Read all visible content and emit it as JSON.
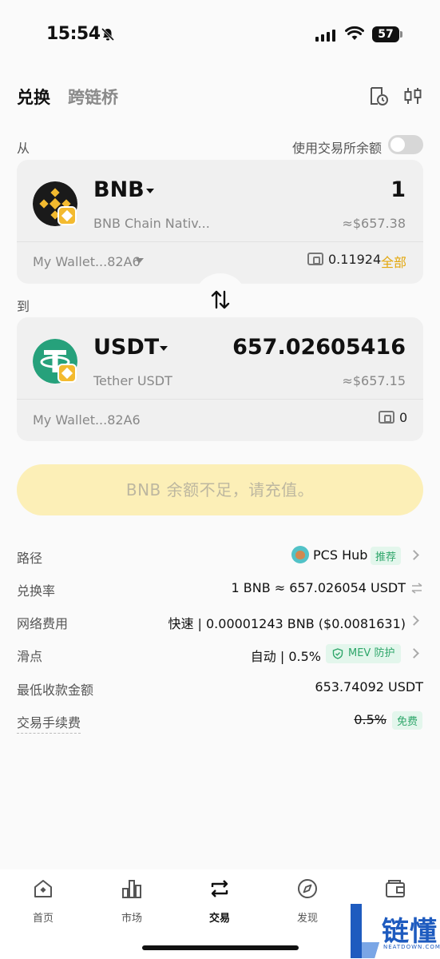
{
  "status_bar": {
    "time": "15:54",
    "battery": "57"
  },
  "header": {
    "tab_swap": "兑换",
    "tab_bridge": "跨链桥"
  },
  "from": {
    "label": "从",
    "use_balance_label": "使用交易所余额",
    "token_symbol": "BNB",
    "token_name": "BNB Chain Nativ...",
    "amount": "1",
    "usd_value": "≈$657.38",
    "wallet": "My Wallet...82A6",
    "balance": "0.11924",
    "all_label": "全部"
  },
  "to": {
    "label": "到",
    "token_symbol": "USDT",
    "token_name": "Tether USDT",
    "amount": "657.02605416",
    "usd_value": "≈$657.15",
    "wallet": "My Wallet...82A6",
    "balance": "0"
  },
  "action_button": "BNB 余额不足，请充值。",
  "details": {
    "route_label": "路径",
    "route_value": "PCS Hub",
    "route_tag": "推荐",
    "rate_label": "兑换率",
    "rate_value": "1 BNB ≈ 657.026054 USDT",
    "fee_label": "网络费用",
    "fee_value": "快速 | 0.00001243 BNB ($0.0081631)",
    "slippage_label": "滑点",
    "slippage_value": "自动 | 0.5%",
    "mev_tag": "MEV 防护",
    "min_receive_label": "最低收款金额",
    "min_receive_value": "653.74092 USDT",
    "trade_fee_label": "交易手续费",
    "trade_fee_value": "0.5%",
    "trade_fee_tag": "免费"
  },
  "nav": [
    {
      "label": "首页",
      "icon": "home-icon"
    },
    {
      "label": "市场",
      "icon": "chart-icon"
    },
    {
      "label": "交易",
      "icon": "swap-icon"
    },
    {
      "label": "发现",
      "icon": "compass-icon"
    },
    {
      "label": "",
      "icon": "wallet-icon"
    }
  ],
  "watermark": {
    "text": "链懂",
    "sub": "NEATDOWN.COM"
  },
  "colors": {
    "accent": "#e3a70d",
    "button_bg": "#fcefb7",
    "tag_green": "#2ea66a",
    "bnb": "#f3ba2f",
    "usdt": "#26a17b"
  }
}
